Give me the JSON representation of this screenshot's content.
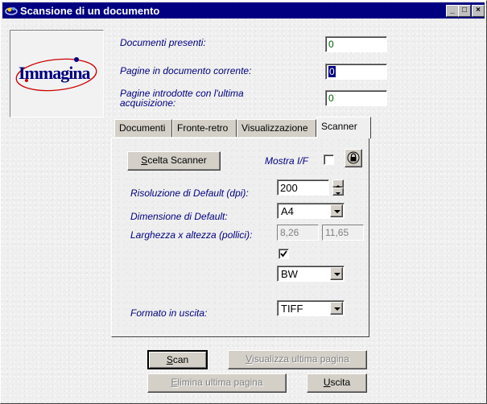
{
  "window": {
    "title": "Scansione di un documento",
    "controls": {
      "minimize": "_",
      "maximize": "□",
      "close": "×"
    }
  },
  "logo": {
    "text": "Immagina"
  },
  "info": {
    "docs_label": "Documenti presenti:",
    "docs_value": "0",
    "pages_label": "Pagine in documento corrente:",
    "pages_value": "0",
    "last_label_line1": "Pagine introdotte con l'ultima",
    "last_label_line2": "acquisizione:",
    "last_value": "0"
  },
  "tabs": [
    {
      "label": "Documenti"
    },
    {
      "label": "Fronte-retro"
    },
    {
      "label": "Visualizzazione"
    },
    {
      "label": "Scanner"
    }
  ],
  "scanner": {
    "choose_button": {
      "pre": "",
      "ul": "S",
      "post": "celta Scanner"
    },
    "show_if_label": "Mostra I/F",
    "show_if_checked": false,
    "lock_icon": "lock-icon",
    "resolution_label": "Risoluzione di Default (dpi):",
    "resolution_value": "200",
    "dimension_label": "Dimensione di Default:",
    "dimension_value": "A4",
    "size_label": "Larghezza x altezza (pollici):",
    "width_value": "8,26",
    "height_value": "11,65",
    "extra_checked": true,
    "mode_value": "BW",
    "output_label": "Formato in uscita:",
    "output_value": "TIFF"
  },
  "actions": {
    "scan": {
      "ul": "S",
      "post": "can"
    },
    "view_last": {
      "ul": "V",
      "post": "isualizza ultima pagina"
    },
    "delete_last": {
      "ul": "E",
      "post": "limina ultima pagina"
    },
    "exit": {
      "ul": "U",
      "post": "scita"
    }
  },
  "colors": {
    "titlebar": "#000080",
    "label": "#000080",
    "field_text": "#006000",
    "logo_text": "#000080",
    "logo_orbit": "#cc0000"
  }
}
